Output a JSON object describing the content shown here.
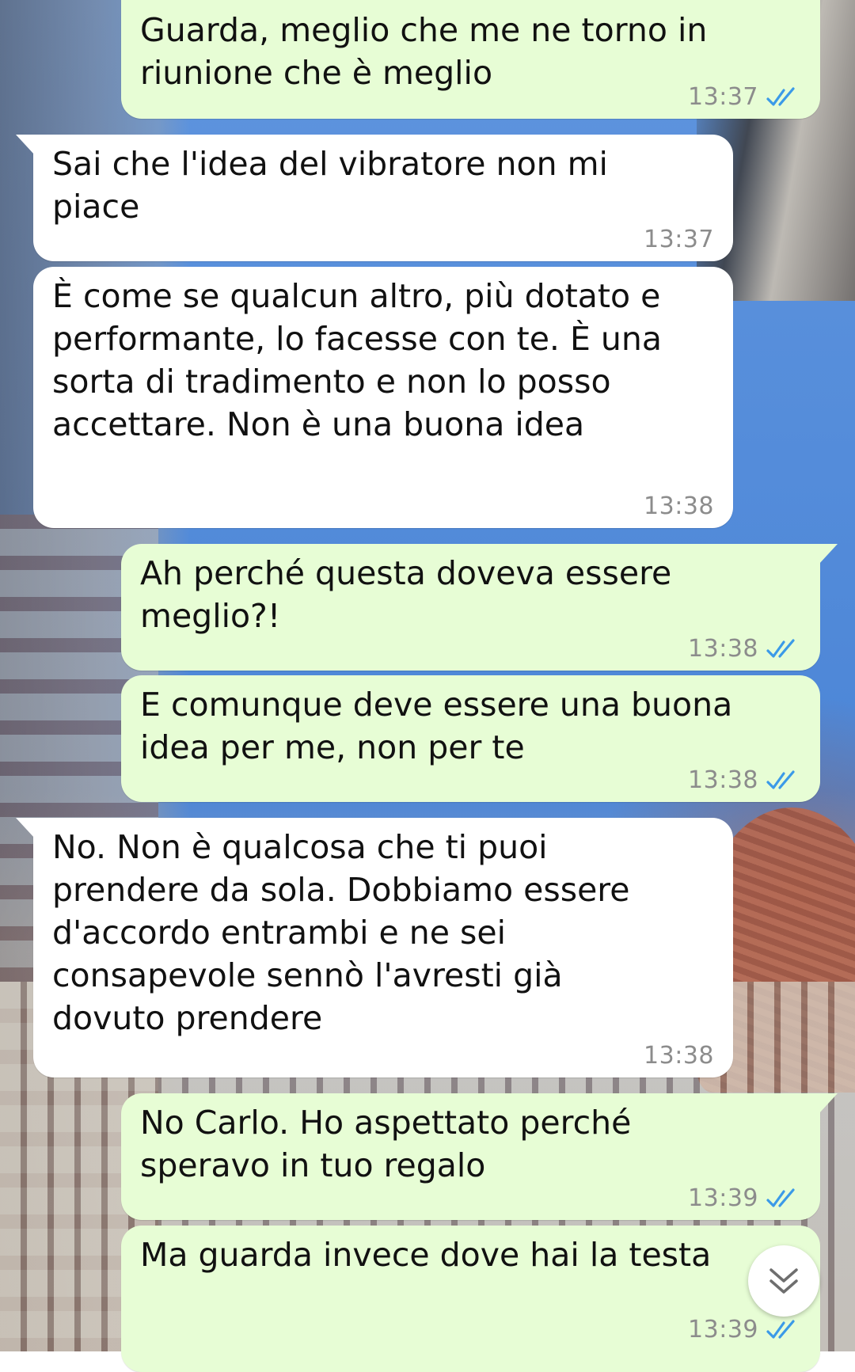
{
  "colors": {
    "outgoing_bubble": "#e7fdd5",
    "incoming_bubble": "#ffffff",
    "timestamp": "#8c8c8c",
    "read_ticks": "#3b9ae8"
  },
  "messages": [
    {
      "direction": "outgoing",
      "text": "Guarda, meglio che me ne torno in riunione che è meglio",
      "time": "13:37",
      "status": "read"
    },
    {
      "direction": "incoming",
      "text": "Sai che l'idea del vibratore non mi piace",
      "time": "13:37"
    },
    {
      "direction": "incoming",
      "text": "È come se qualcun altro, più dotato e performante, lo facesse con te. È una sorta di tradimento e non lo posso accettare. Non è una buona idea",
      "time": "13:38"
    },
    {
      "direction": "outgoing",
      "text": "Ah perché questa doveva essere meglio?!",
      "time": "13:38",
      "status": "read"
    },
    {
      "direction": "outgoing",
      "text": "E comunque deve essere una buona idea per me, non per te",
      "time": "13:38",
      "status": "read"
    },
    {
      "direction": "incoming",
      "text": "No. Non è qualcosa che ti puoi prendere da sola. Dobbiamo essere d'accordo entrambi e ne sei consapevole sennò l'avresti già dovuto prendere",
      "time": "13:38"
    },
    {
      "direction": "outgoing",
      "text": "No Carlo. Ho aspettato perché speravo in tuo regalo",
      "time": "13:39",
      "status": "read"
    },
    {
      "direction": "outgoing",
      "text": "Ma guarda invece dove hai la testa",
      "time": "13:39",
      "status": "read"
    }
  ],
  "icons": {
    "read_receipt": "double-check-icon",
    "scroll_down": "chevron-double-down-icon"
  }
}
